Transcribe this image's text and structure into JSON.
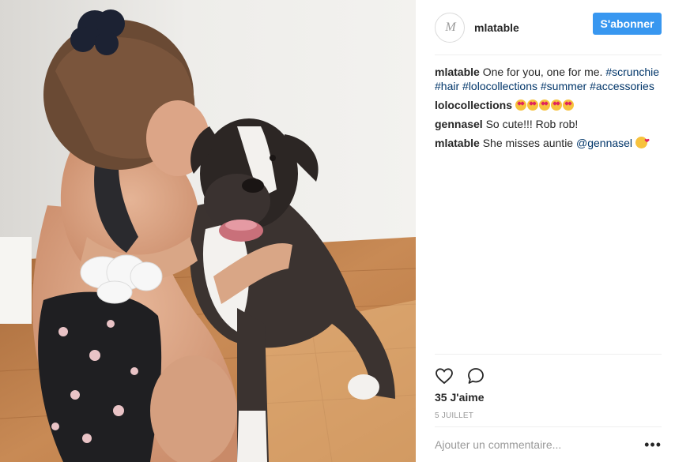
{
  "post": {
    "image_alt": "Woman hugging a brindle boxer dog on a wooden floor, wearing white and dark scrunchies"
  },
  "header": {
    "avatar_text": "M",
    "username": "mlatable",
    "follow_label": "S'abonner"
  },
  "caption": {
    "author": "mlatable",
    "text": "One for you, one for me.",
    "hashtags": [
      "#scrunchie",
      "#hair",
      "#lolocollections",
      "#summer",
      "#accessories"
    ]
  },
  "comments": [
    {
      "author": "lolocollections",
      "text": "",
      "emoji": "heart-eyes-face-x5"
    },
    {
      "author": "gennasel",
      "text": "So cute!!! Rob rob!"
    },
    {
      "author": "mlatable",
      "text": "She misses auntie",
      "mention": "@gennasel",
      "emoji": "kissing-face"
    }
  ],
  "actions": {
    "like_icon": "heart-icon",
    "comment_icon": "comment-bubble-icon",
    "likes_text": "35 J'aime",
    "date_text": "5 JUILLET"
  },
  "add_comment": {
    "placeholder": "Ajouter un commentaire...",
    "more_label": "•••"
  },
  "colors": {
    "follow_button": "#3897f0",
    "link": "#003569",
    "border": "#efefef"
  }
}
